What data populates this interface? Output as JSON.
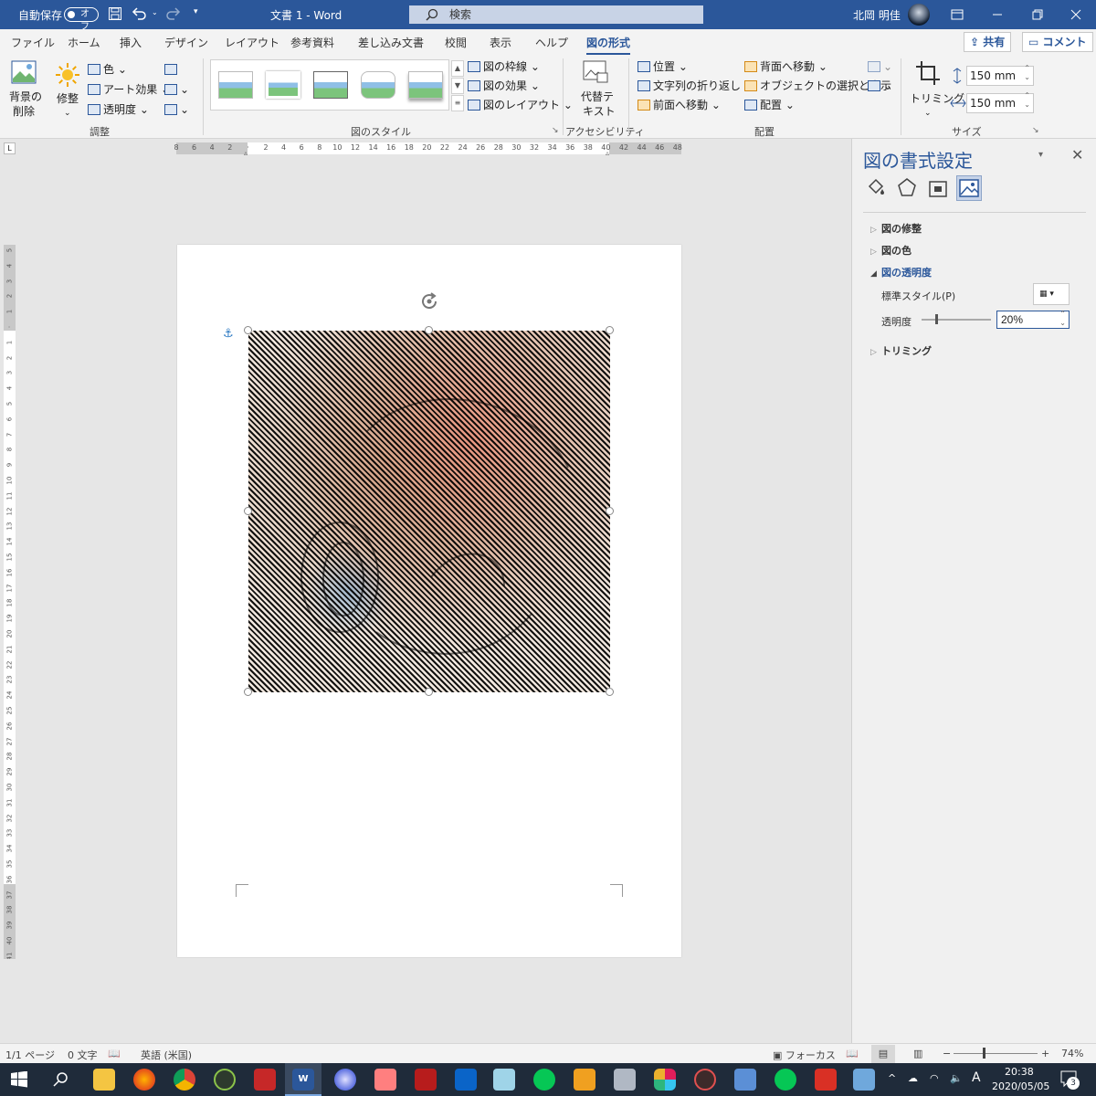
{
  "titlebar": {
    "autosave_label": "自動保存",
    "autosave_state": "オフ",
    "doc_title": "文書 1  -  Word",
    "search_placeholder": "検索",
    "user_name": "北岡 明佳"
  },
  "tabs": {
    "items": [
      "ファイル",
      "ホーム",
      "挿入",
      "デザイン",
      "レイアウト",
      "参考資料",
      "差し込み文書",
      "校閲",
      "表示",
      "ヘルプ",
      "図の形式"
    ],
    "active": "図の形式",
    "share": "共有",
    "comment": "コメント"
  },
  "ribbon": {
    "remove_bg": [
      "背景の",
      "削除"
    ],
    "corrections": "修整",
    "color": "色",
    "art_effects": "アート効果",
    "transparency": "透明度",
    "group_adjust": "調整",
    "border": "図の枠線",
    "effects": "図の効果",
    "layout": "図のレイアウト",
    "group_styles": "図のスタイル",
    "alt_text": [
      "代替テ",
      "キスト"
    ],
    "group_access": "アクセシビリティ",
    "position": "位置",
    "wrap": "文字列の折り返し",
    "forward": "前面へ移動",
    "backward": "背面へ移動",
    "selection": "オブジェクトの選択と表示",
    "align": "配置",
    "group_arrange": "配置",
    "crop": "トリミング",
    "height": "150 mm",
    "width": "150 mm",
    "group_size": "サイズ"
  },
  "ruler": {
    "h_ticks": [
      "8",
      "6",
      "4",
      "2",
      "",
      "2",
      "4",
      "6",
      "8",
      "10",
      "12",
      "14",
      "16",
      "18",
      "20",
      "22",
      "24",
      "26",
      "28",
      "30",
      "32",
      "34",
      "36",
      "38",
      "40",
      "42",
      "44",
      "46",
      "48"
    ],
    "v_ticks": [
      "5",
      "4",
      "3",
      "2",
      "1",
      "",
      "1",
      "2",
      "3",
      "4",
      "5",
      "6",
      "7",
      "8",
      "9",
      "10",
      "11",
      "12",
      "13",
      "14",
      "15",
      "16",
      "17",
      "18",
      "19",
      "20",
      "21",
      "22",
      "23",
      "24",
      "25",
      "26",
      "27",
      "28",
      "29",
      "30",
      "31",
      "32",
      "33",
      "34",
      "35",
      "36",
      "37",
      "38",
      "39",
      "40",
      "41"
    ]
  },
  "pane": {
    "title": "図の書式設定",
    "sections": {
      "corrections": "図の修整",
      "color": "図の色",
      "transparency": "図の透明度",
      "crop": "トリミング"
    },
    "preset_label": "標準スタイル(P)",
    "transparency_label": "透明度",
    "transparency_value": "20%",
    "transparency_fraction": 0.2
  },
  "status": {
    "page": "1/1 ページ",
    "words": "0 文字",
    "language": "英語 (米国)",
    "focus": "フォーカス",
    "zoom": "74%"
  },
  "taskbar": {
    "time": "20:38",
    "date": "2020/05/05",
    "ime": "A",
    "notif_count": "3"
  }
}
